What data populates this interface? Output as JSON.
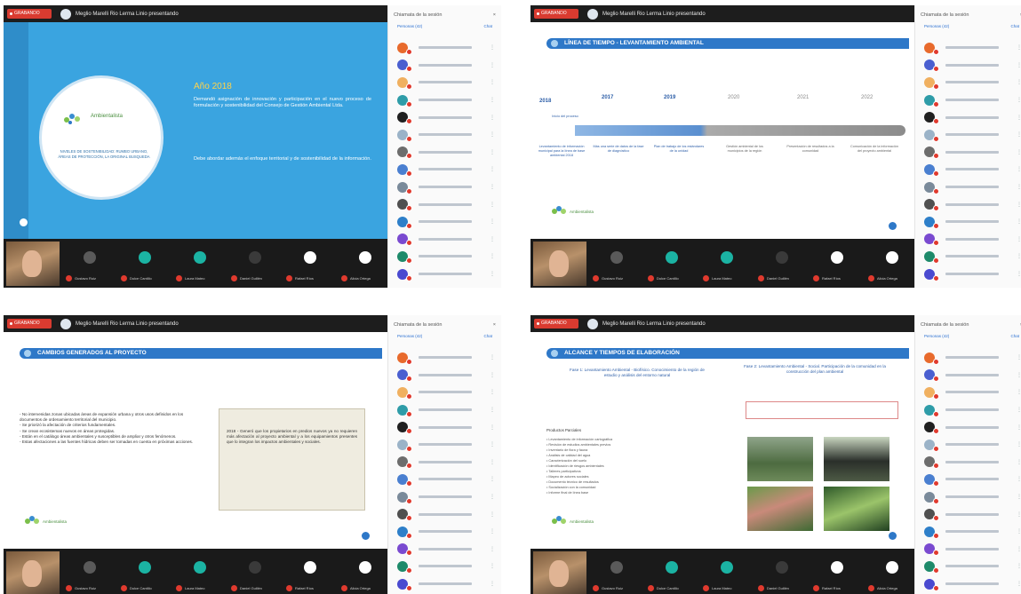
{
  "meeting": {
    "record_label": "GRABANDO",
    "title": "Meglio Marelli Rio Lerma Linio presentando",
    "participants_title": "Chiamata de la sesión",
    "participants_tab_active": "Personas (42)",
    "participants_tab_other": "Chat"
  },
  "video_tiles": [
    {
      "name": "Gustavo Ruiz"
    },
    {
      "name": "Dulce Cantillo"
    },
    {
      "name": "Laura Mateo"
    },
    {
      "name": "Daniel Guillén"
    },
    {
      "name": "Rafael Ríos"
    },
    {
      "name": "Alicia Ortega"
    }
  ],
  "slides": {
    "s0": {
      "logo_text": "Ambientalista",
      "logo_sub": "NIVELES DE SOSTENIBILIDAD: RUMBO URBANO, ÁREAS DE PROTECCIÓN, LA ORIGINAL BUSQUEDA",
      "heading": "Año 2018",
      "body": "Demandó asignación de innovación y participación en el nuevo proceso de formulación y sostenibilidad del Consejo de Gestión Ambiental Ltda.",
      "body2": "Debe abordar además el enfoque territorial y de sostenibilidad de la información."
    },
    "s1": {
      "title": "LÍNEA DE TIEMPO - LEVANTAMIENTO AMBIENTAL",
      "years": [
        "2018",
        "2017",
        "2019",
        "2020",
        "2021",
        "2022"
      ],
      "start_label": "Inicio del proceso",
      "notes": [
        "Levantamiento de información municipal para la línea de base ambiental 2018",
        "Más una serie de datos de la fase de diagnóstico",
        "Plan de trabajo de los estándares de la unidad",
        "Gestión ambiental de los municipios de la región",
        "Presentación de resultados a la comunidad",
        "Comunicación de la información del proyecto ambiental"
      ]
    },
    "s2": {
      "title": "CAMBIOS GENERADOS AL PROYECTO",
      "list": [
        "No intervenidas zonas ubicadas áreas de expansión urbana y otros usos definidos en los documentos de ordenamiento territorial del municipio.",
        "Se priorizó la afectación de criterios fundamentales.",
        "Se crean ecosistemas nuevos en áreas protegidas.",
        "Están en el catálogo áreas ambientales y susceptibles de ampliar y otros fenómenos.",
        "Estas afectaciones a las fuentes hídricas deben ser tomadas en cuenta en próximas acciones."
      ],
      "box_text": "2018 - Generó que los propietarios en predios nuevos ya no requieren más afectación al proyecto ambiental y a los equipamientos presentes que lo integran los impactos ambientales y sociales."
    },
    "s3": {
      "title": "ALCANCE Y TIEMPOS DE ELABORACIÓN",
      "col1_title": "Fase 1: Levantamiento Ambiental - Biofísico. Conocimiento de la región de estudio y análisis del entorno natural",
      "col2_title": "Fase 2: Levantamiento Ambiental - Social. Participación de la comunidad en la construcción del plan ambiental",
      "list_header": "Productos Parciales",
      "list": [
        "Levantamiento de información cartográfica",
        "Revisión de estudios ambientales previos",
        "Inventario de flora y fauna",
        "Análisis de calidad del agua",
        "Caracterización del suelo",
        "Identificación de riesgos ambientales",
        "Talleres participativos",
        "Mapeo de actores sociales",
        "Documento técnico de resultados",
        "Socialización con la comunidad",
        "Informe final de línea base"
      ]
    }
  },
  "colors": {
    "slide_blue": "#3aa4e0",
    "title_bar": "#2e78c8",
    "heading_yellow": "#ffd34a",
    "record_red": "#d93b30"
  }
}
